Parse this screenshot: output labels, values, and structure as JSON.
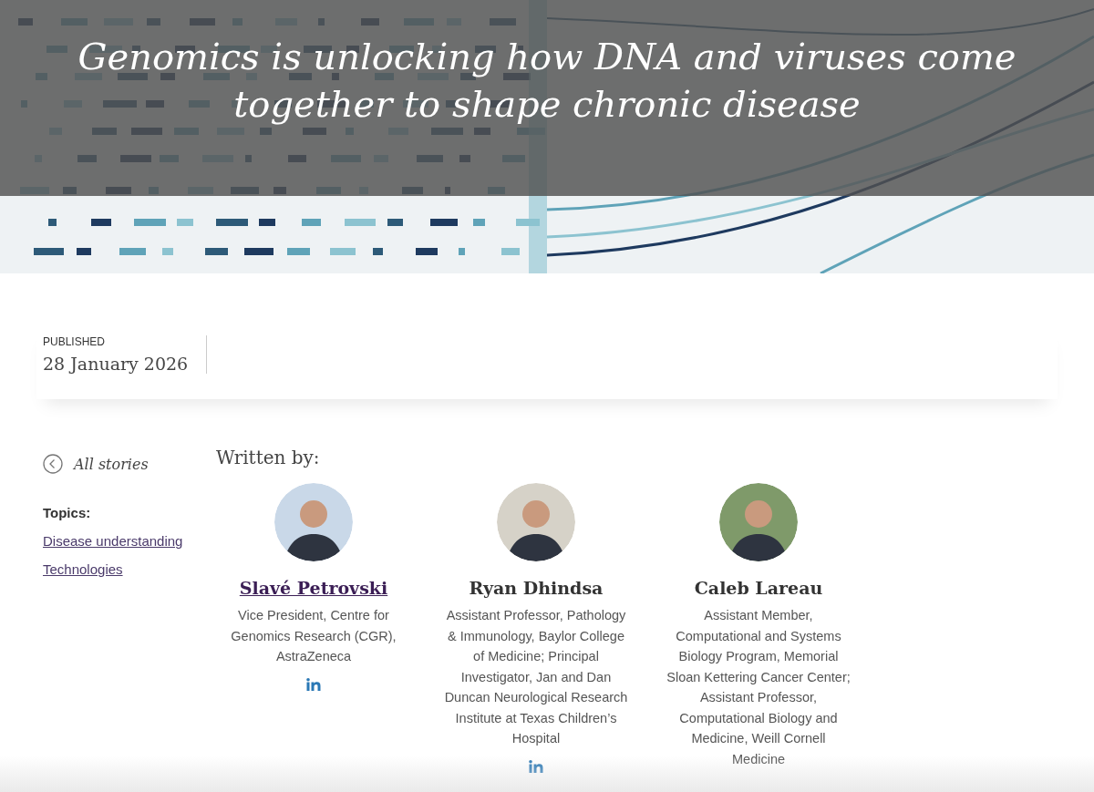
{
  "hero": {
    "kind": "picture",
    "title": "Genomics is unlocking how DNA and viruses come together to shape chronic disease"
  },
  "published": {
    "label": "PUBLISHED",
    "date": "28 January 2026"
  },
  "sidebar": {
    "back_link": "All stories",
    "topics_label": "Topics:",
    "topics": [
      "Disease understanding",
      "Technologies"
    ]
  },
  "written_by": "Written by:",
  "authors": [
    {
      "name": "Slavé Petrovski",
      "link": true,
      "role": "Vice President, Centre for Genomics Research (CGR), AstraZeneca",
      "linkedin": true,
      "color": "#c9d8e8"
    },
    {
      "name": "Ryan Dhindsa",
      "link": false,
      "role": "Assistant Professor, Pathology & Immunology, Baylor College of Medicine; Principal Investigator, Jan and Dan Duncan Neurological Research Institute at Texas Children’s Hospital",
      "linkedin": true,
      "color": "#d6d2c8"
    },
    {
      "name": "Caleb Lareau",
      "link": false,
      "role": "Assistant Member, Computational and Systems Biology Program, Memorial Sloan Kettering Cancer Center; Assistant Professor, Computational Biology and Medicine, Weill Cornell Medicine",
      "color": "#7f9a6a"
    }
  ]
}
